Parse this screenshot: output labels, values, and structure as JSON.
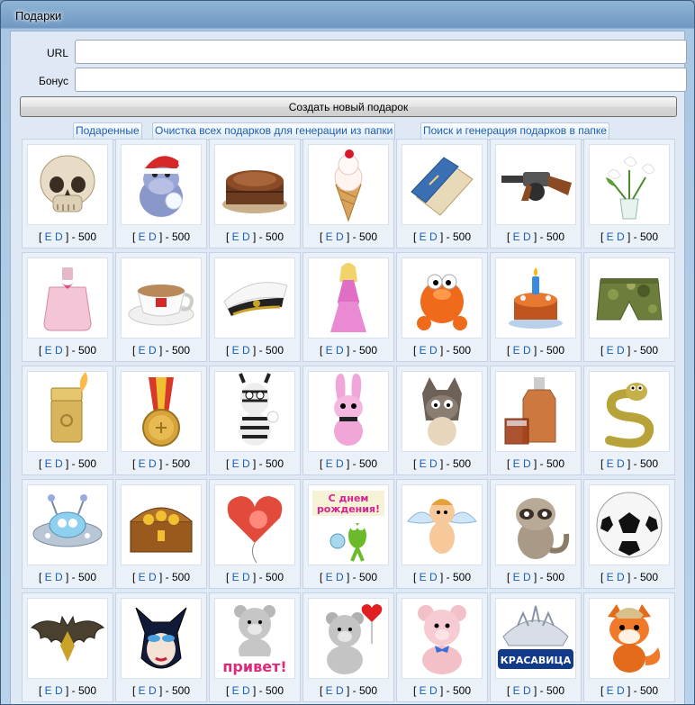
{
  "window": {
    "title": "Подарки"
  },
  "form": {
    "url_label": "URL",
    "bonus_label": "Бонус",
    "url_value": "",
    "bonus_value": "",
    "create_label": "Создать новый подарок"
  },
  "toolbar": [
    "Подаренные",
    "Очистка всех подарков для генерации из папки",
    "Поиск и генерация подарков в папке"
  ],
  "gift_caption": {
    "open": "[ ",
    "e": "E",
    "d": "D",
    "close": " ] - 500"
  },
  "gifts": [
    {
      "icon": "skull-icon"
    },
    {
      "icon": "hippo-santa-icon"
    },
    {
      "icon": "cake-icon"
    },
    {
      "icon": "ice-cream-icon"
    },
    {
      "icon": "passport-icon"
    },
    {
      "icon": "tommy-gun-icon"
    },
    {
      "icon": "calla-vase-icon"
    },
    {
      "icon": "perfume-icon"
    },
    {
      "icon": "coffee-cup-icon"
    },
    {
      "icon": "navy-cap-icon"
    },
    {
      "icon": "doll-icon"
    },
    {
      "icon": "orange-monster-icon"
    },
    {
      "icon": "birthday-cake-icon"
    },
    {
      "icon": "camo-shorts-icon"
    },
    {
      "icon": "lighter-icon"
    },
    {
      "icon": "medal-icon"
    },
    {
      "icon": "zebra-icon"
    },
    {
      "icon": "bunny-icon"
    },
    {
      "icon": "wolf-icon"
    },
    {
      "icon": "whisky-icon"
    },
    {
      "icon": "snake-icon"
    },
    {
      "icon": "ufo-icon"
    },
    {
      "icon": "treasure-chest-icon"
    },
    {
      "icon": "heart-balloon-icon"
    },
    {
      "icon": "birthday-alien-icon"
    },
    {
      "icon": "cupid-icon"
    },
    {
      "icon": "raccoon-icon"
    },
    {
      "icon": "soccer-ball-icon"
    },
    {
      "icon": "bat-icon"
    },
    {
      "icon": "cat-mask-icon"
    },
    {
      "icon": "teddy-privet-icon"
    },
    {
      "icon": "teddy-heart-icon"
    },
    {
      "icon": "pink-bear-icon"
    },
    {
      "icon": "tiara-icon"
    },
    {
      "icon": "fox-icon"
    }
  ],
  "stickers": {
    "privet": "привет!",
    "krasavica": "КРАСАВИЦА",
    "sdnem": "С днем",
    "rozhdeniya": "рождения!"
  }
}
